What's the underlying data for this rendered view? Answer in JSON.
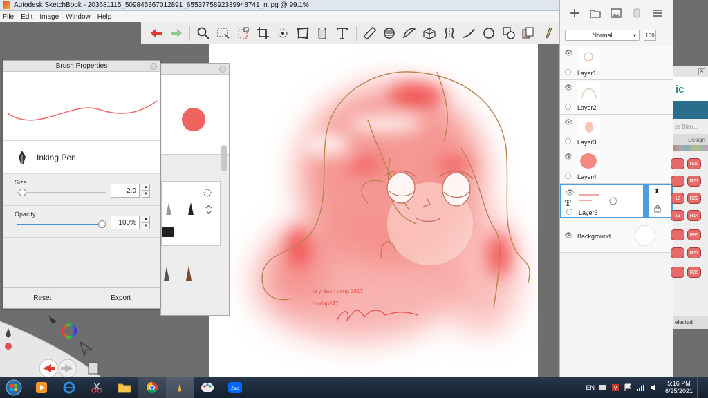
{
  "window": {
    "title": "Autodesk SketchBook - 203681115_509845367012891_6553775892339948741_n.jpg @ 99.1%"
  },
  "menu": [
    "File",
    "Edit",
    "Image",
    "Window",
    "Help"
  ],
  "toolbar": {
    "icons": [
      "undo-icon",
      "redo-icon",
      "zoom-icon",
      "select-icon",
      "lasso-icon",
      "crop-icon",
      "transform-icon",
      "distort-icon",
      "fill-icon",
      "text-icon",
      "ruler-icon",
      "ellipse-icon",
      "french-curve-icon",
      "perspective-icon",
      "symmetry-icon",
      "stroke-icon",
      "circle-icon",
      "shapes-icon",
      "copy-icon",
      "brush-icon"
    ]
  },
  "brush_properties": {
    "title": "Brush Properties",
    "brush_name": "Inking Pen",
    "size_label": "Size",
    "size_value": "2.0",
    "size_fraction": 0.02,
    "opacity_label": "Opacity",
    "opacity_value": "100%",
    "opacity_fraction": 1.0,
    "reset_label": "Reset",
    "export_label": "Export",
    "stroke_color": "#f06a6a"
  },
  "brush_library": {
    "current_color": "#f0645f"
  },
  "canvas": {
    "annotation_line1": "ta y danh dong 2617",
    "annotation_line2": "hoidap247"
  },
  "layers": {
    "blend_mode": "Normal",
    "opacity": "100",
    "items": [
      {
        "name": "Layer1",
        "visible": true,
        "selected": false
      },
      {
        "name": "Layer2",
        "visible": true,
        "selected": false
      },
      {
        "name": "Layer3",
        "visible": true,
        "selected": false
      },
      {
        "name": "Layer4",
        "visible": true,
        "selected": false
      },
      {
        "name": "Layer5",
        "visible": true,
        "selected": true
      },
      {
        "name": "Background",
        "visible": true,
        "selected": false
      }
    ]
  },
  "marker_palette": {
    "header": "ic",
    "subtitle": "ss Blen...",
    "tab": "Design",
    "footer": "elected",
    "left_column": [
      "",
      "",
      "12",
      "13",
      "",
      "",
      ""
    ],
    "right_column": [
      "R20",
      "R21",
      "R22",
      "R14",
      "R85",
      "R27",
      "R39"
    ]
  },
  "taskbar": {
    "language": "EN",
    "time": "5:16 PM",
    "date": "6/25/2021",
    "apps": [
      "start-orb",
      "media-player",
      "internet-explorer",
      "snipping-tool",
      "file-explorer",
      "chrome",
      "sketchbook",
      "paint",
      "zalo"
    ]
  },
  "colors": {
    "accent_red": "#f06a6a",
    "hair_line": "#b9834f",
    "selection_blue": "#4a9ee0"
  }
}
